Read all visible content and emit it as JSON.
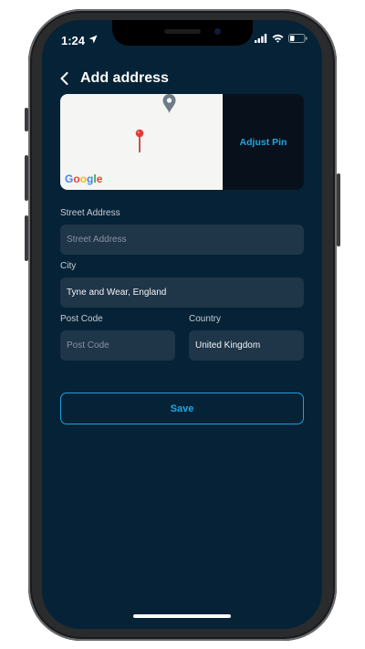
{
  "status_bar": {
    "time": "1:24",
    "icons": [
      "location-arrow-icon",
      "signal-icon",
      "wifi-icon",
      "battery-icon"
    ]
  },
  "header": {
    "back_icon": "chevron-left-icon",
    "title": "Add address"
  },
  "map": {
    "logo_text": "Google",
    "adjust_pin_label": "Adjust Pin",
    "icons": [
      "grey-map-pin-icon",
      "red-map-pin-icon"
    ]
  },
  "form": {
    "street_address": {
      "label": "Street Address",
      "placeholder": "Street Address",
      "value": ""
    },
    "city": {
      "label": "City",
      "value": "Tyne and Wear, England"
    },
    "post_code": {
      "label": "Post Code",
      "placeholder": "Post Code",
      "value": ""
    },
    "country": {
      "label": "Country",
      "value": "United Kingdom"
    }
  },
  "save_label": "Save",
  "colors": {
    "background": "#062236",
    "field": "#1f3548",
    "accent": "#22a6e0",
    "text": "#ffffff",
    "muted": "#c7ced6"
  }
}
